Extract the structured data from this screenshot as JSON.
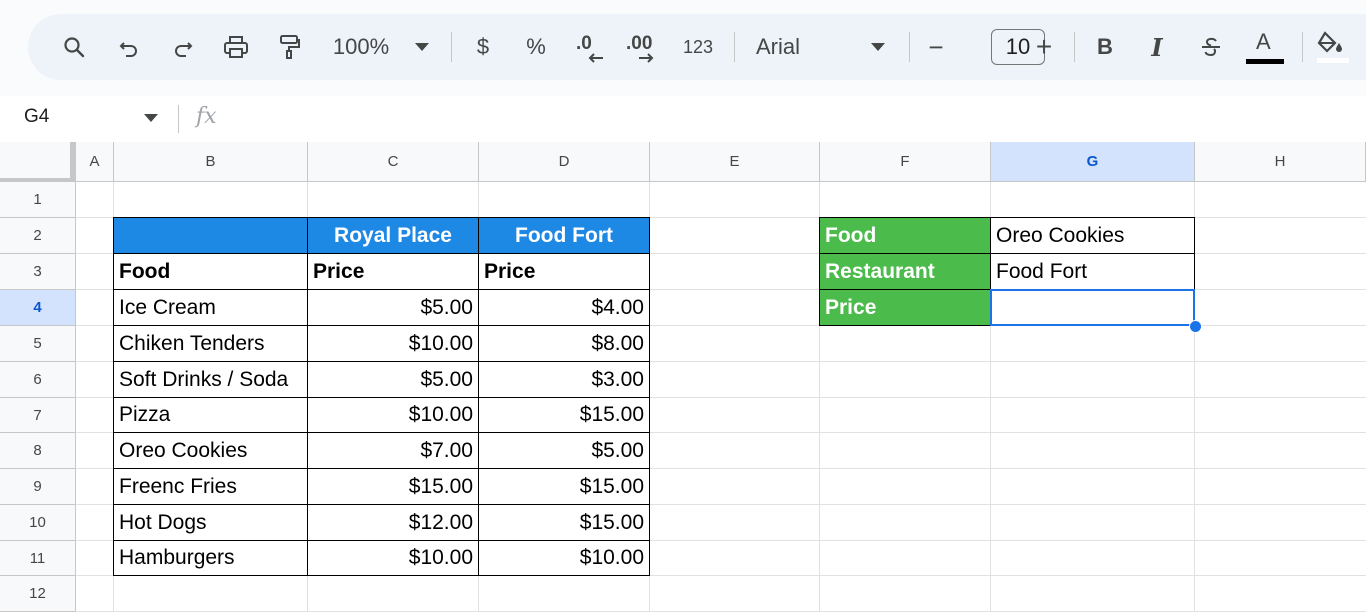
{
  "toolbar": {
    "zoom": "100%",
    "currency": "$",
    "percent": "%",
    "dec_decrease": ".0",
    "dec_increase": ".00",
    "number_format": "123",
    "font": "Arial",
    "font_size": "10",
    "minus": "−",
    "plus": "+",
    "bold": "B",
    "italic": "I",
    "text_color": "A"
  },
  "formula_bar": {
    "name_box": "G4",
    "fx": "fx",
    "value": ""
  },
  "columns": [
    "A",
    "B",
    "C",
    "D",
    "E",
    "F",
    "G",
    "H"
  ],
  "rows": [
    "1",
    "2",
    "3",
    "4",
    "5",
    "6",
    "7",
    "8",
    "9",
    "10",
    "11",
    "12"
  ],
  "selected_cell": "G4",
  "table": {
    "header": [
      "",
      "Royal Place",
      "Food Fort"
    ],
    "subheader": [
      "Food",
      "Price",
      "Price"
    ],
    "rows": [
      [
        "Ice Cream",
        "$5.00",
        "$4.00"
      ],
      [
        "Chiken Tenders",
        "$10.00",
        "$8.00"
      ],
      [
        "Soft Drinks / Soda",
        "$5.00",
        "$3.00"
      ],
      [
        "Pizza",
        "$10.00",
        "$15.00"
      ],
      [
        "Oreo Cookies",
        "$7.00",
        "$5.00"
      ],
      [
        "Freenc Fries",
        "$15.00",
        "$15.00"
      ],
      [
        "Hot Dogs",
        "$12.00",
        "$15.00"
      ],
      [
        "Hamburgers",
        "$10.00",
        "$10.00"
      ]
    ]
  },
  "lookup": [
    {
      "label": "Food",
      "value": "Oreo Cookies"
    },
    {
      "label": "Restaurant",
      "value": "Food Fort"
    },
    {
      "label": "Price",
      "value": ""
    }
  ],
  "colors": {
    "header_blue": "#1e88e5",
    "label_green": "#4bbb4b",
    "selection": "#1a73e8"
  }
}
